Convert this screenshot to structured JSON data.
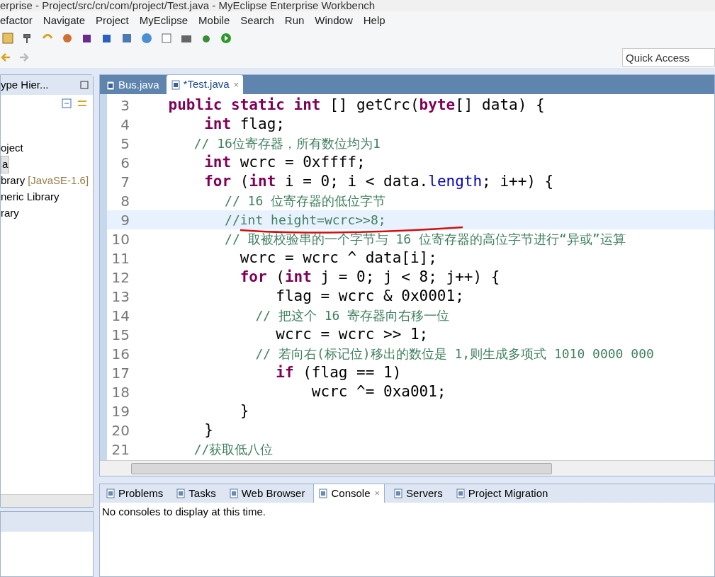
{
  "window": {
    "title": "erprise - Project/src/cn/com/project/Test.java - MyEclipse Enterprise Workbench"
  },
  "menu": [
    "efactor",
    "Navigate",
    "Project",
    "MyEclipse",
    "Mobile",
    "Search",
    "Run",
    "Window",
    "Help"
  ],
  "quick_access": {
    "placeholder": "Quick Access"
  },
  "left_panel": {
    "tab": "ype Hier...",
    "items": [
      {
        "text": "oject",
        "selected": false
      },
      {
        "text": "a",
        "selected": true
      },
      {
        "text": "brary",
        "suffix": "[JavaSE-1.6]",
        "selected": false
      },
      {
        "text": "neric Library",
        "selected": false
      },
      {
        "text": "rary",
        "selected": false
      }
    ]
  },
  "editor": {
    "tabs": [
      {
        "label": "Bus.java",
        "selected": false
      },
      {
        "label": "*Test.java",
        "selected": true,
        "close": "×"
      }
    ],
    "lines": [
      {
        "number": "3",
        "current": false,
        "underlined": false,
        "tokens": [
          {
            "kind": "keyword",
            "text": "    public static int"
          },
          {
            "kind": "plain",
            "text": " [] getCrc("
          },
          {
            "kind": "keyword",
            "text": "byte"
          },
          {
            "kind": "plain",
            "text": "[] data) {"
          }
        ]
      },
      {
        "number": "4",
        "current": false,
        "underlined": false,
        "tokens": [
          {
            "kind": "keyword",
            "text": "        int"
          },
          {
            "kind": "plain",
            "text": " flag;"
          }
        ]
      },
      {
        "number": "5",
        "current": false,
        "underlined": false,
        "tokens": [
          {
            "kind": "comment",
            "text": "        // 16位寄存器，所有数位均为1"
          }
        ]
      },
      {
        "number": "6",
        "current": false,
        "underlined": false,
        "tokens": [
          {
            "kind": "keyword",
            "text": "        int"
          },
          {
            "kind": "plain",
            "text": " wcrc = 0xffff;"
          }
        ]
      },
      {
        "number": "7",
        "current": false,
        "underlined": false,
        "tokens": [
          {
            "kind": "keyword",
            "text": "        for"
          },
          {
            "kind": "plain",
            "text": " ("
          },
          {
            "kind": "keyword",
            "text": "int"
          },
          {
            "kind": "plain",
            "text": " i = 0; i < data."
          },
          {
            "kind": "field",
            "text": "length"
          },
          {
            "kind": "plain",
            "text": "; i++) {"
          }
        ]
      },
      {
        "number": "8",
        "current": false,
        "underlined": false,
        "tokens": [
          {
            "kind": "comment",
            "text": "            // 16 位寄存器的低位字节"
          }
        ]
      },
      {
        "number": "9",
        "current": true,
        "underlined": true,
        "tokens": [
          {
            "kind": "comment",
            "text": "            //int height=wcrc>>8;"
          }
        ]
      },
      {
        "number": "10",
        "current": false,
        "underlined": false,
        "tokens": [
          {
            "kind": "comment",
            "text": "            // 取被校验串的一个字节与 16 位寄存器的高位字节进行“异或”运算"
          }
        ]
      },
      {
        "number": "11",
        "current": false,
        "underlined": false,
        "tokens": [
          {
            "kind": "plain",
            "text": "            wcrc = wcrc ^ data[i];"
          }
        ]
      },
      {
        "number": "12",
        "current": false,
        "underlined": false,
        "tokens": [
          {
            "kind": "keyword",
            "text": "            for"
          },
          {
            "kind": "plain",
            "text": " ("
          },
          {
            "kind": "keyword",
            "text": "int"
          },
          {
            "kind": "plain",
            "text": " j = 0; j < 8; j++) {"
          }
        ]
      },
      {
        "number": "13",
        "current": false,
        "underlined": false,
        "tokens": [
          {
            "kind": "plain",
            "text": "                flag = wcrc & 0x0001;"
          }
        ]
      },
      {
        "number": "14",
        "current": false,
        "underlined": false,
        "tokens": [
          {
            "kind": "comment",
            "text": "                // 把这个 16 寄存器向右移一位"
          }
        ]
      },
      {
        "number": "15",
        "current": false,
        "underlined": false,
        "tokens": [
          {
            "kind": "plain",
            "text": "                wcrc = wcrc >> 1;"
          }
        ]
      },
      {
        "number": "16",
        "current": false,
        "underlined": false,
        "tokens": [
          {
            "kind": "comment",
            "text": "                // 若向右(标记位)移出的数位是 1,则生成多项式 1010 0000 000"
          }
        ]
      },
      {
        "number": "17",
        "current": false,
        "underlined": false,
        "tokens": [
          {
            "kind": "keyword",
            "text": "                if"
          },
          {
            "kind": "plain",
            "text": " (flag == 1)"
          }
        ]
      },
      {
        "number": "18",
        "current": false,
        "underlined": false,
        "tokens": [
          {
            "kind": "plain",
            "text": "                    wcrc ^= 0xa001;"
          }
        ]
      },
      {
        "number": "19",
        "current": false,
        "underlined": false,
        "tokens": [
          {
            "kind": "plain",
            "text": "            }"
          }
        ]
      },
      {
        "number": "20",
        "current": false,
        "underlined": false,
        "tokens": [
          {
            "kind": "plain",
            "text": "        }"
          }
        ]
      },
      {
        "number": "21",
        "current": false,
        "underlined": false,
        "tokens": [
          {
            "kind": "comment",
            "text": "        //获取低八位"
          }
        ]
      }
    ]
  },
  "bottom_panel": {
    "tabs": [
      {
        "label": "Problems",
        "selected": false
      },
      {
        "label": "Tasks",
        "selected": false
      },
      {
        "label": "Web Browser",
        "selected": false
      },
      {
        "label": "Console",
        "selected": true,
        "close": "×"
      },
      {
        "label": "Servers",
        "selected": false
      },
      {
        "label": "Project Migration",
        "selected": false
      }
    ],
    "message": "No consoles to display at this time."
  }
}
